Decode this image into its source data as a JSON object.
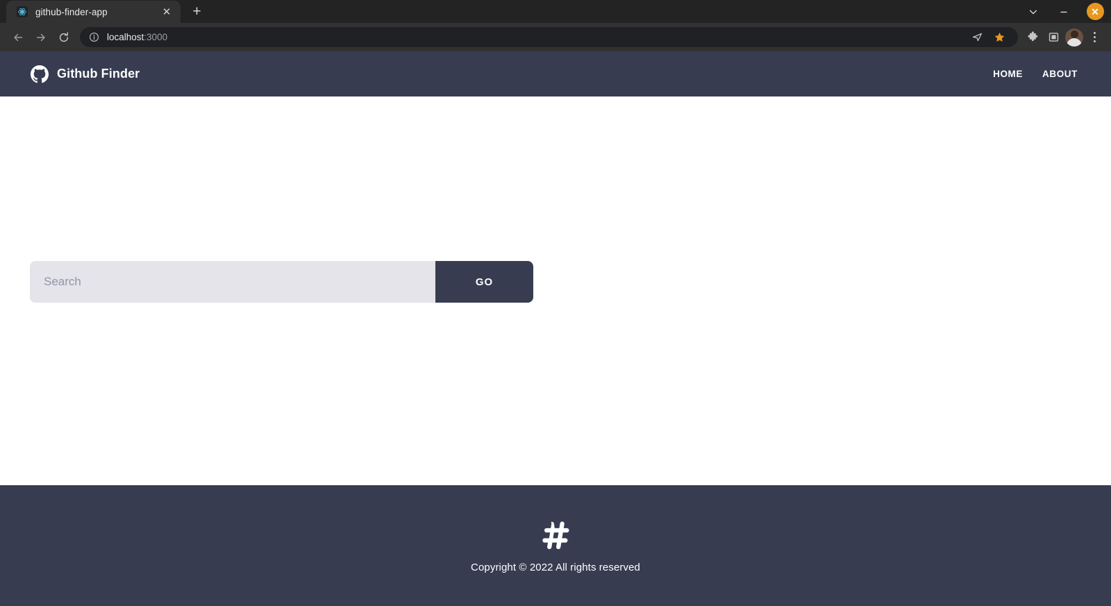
{
  "browser": {
    "tab": {
      "title": "github-finder-app",
      "favicon_name": "react-favicon",
      "close_label": "✕"
    },
    "new_tab_label": "+",
    "window_controls": {
      "chevron_label": "⌄",
      "minimize_label": "–",
      "close_label": "✕"
    },
    "toolbar": {
      "back_label": "←",
      "forward_label": "→",
      "reload_label": "⟳",
      "url_host": "localhost",
      "url_port": ":3000",
      "url_full": "localhost:3000",
      "info_label": "ⓘ",
      "send_label": "➤",
      "star_label": "★",
      "extensions_label": "❖",
      "side_panel_label": "▣",
      "profile_label": "profile"
    }
  },
  "page": {
    "navbar": {
      "brand": "Github Finder",
      "brand_icon": "github-icon",
      "links": [
        {
          "label": "Home"
        },
        {
          "label": "About"
        }
      ]
    },
    "search": {
      "placeholder": "Search",
      "value": "",
      "button_label": "GO"
    },
    "footer": {
      "icon": "hashtag-icon",
      "text": "Copyright © 2022 All rights reserved"
    }
  },
  "colors": {
    "brand_dark": "#373c51",
    "input_bg": "#e4e4ea",
    "page_bg": "#ffffff",
    "chrome_bg": "#323232",
    "accent_orange": "#e8971f"
  }
}
